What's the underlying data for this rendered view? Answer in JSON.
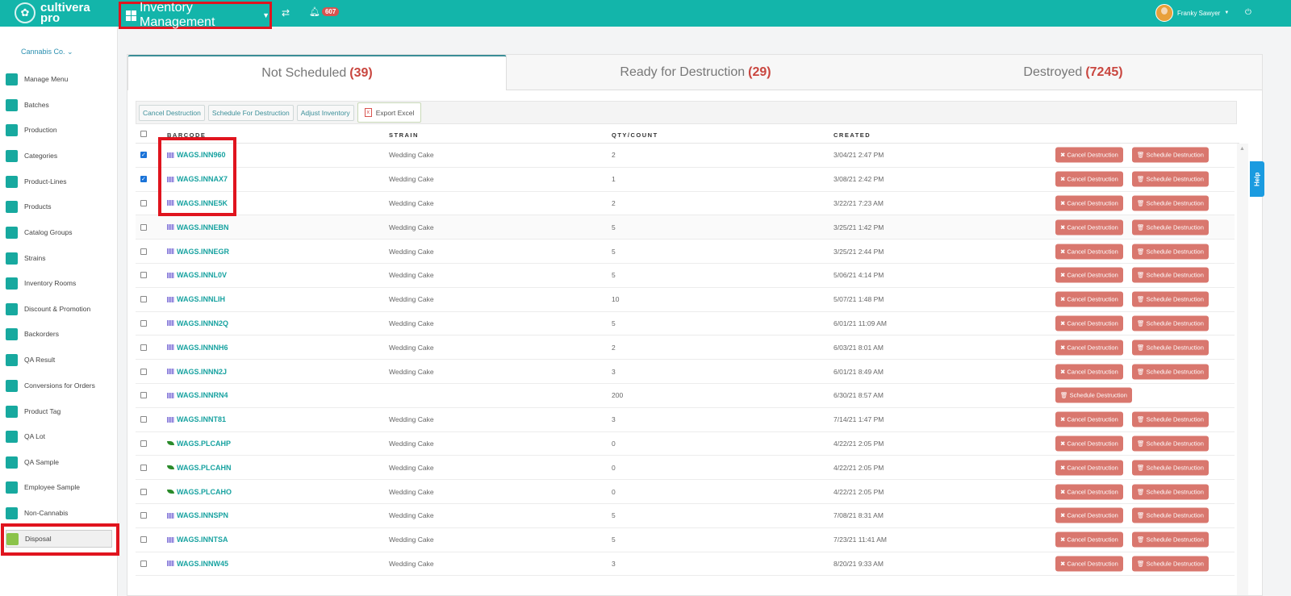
{
  "topbar": {
    "logo_line1": "cultivera",
    "logo_line2": "pro",
    "module_title": "Inventory Management",
    "notifications_count": "607",
    "user_name": "Franky Sawyer"
  },
  "sidebar": {
    "company": "Cannabis Co.",
    "items": [
      {
        "label": "Manage Menu"
      },
      {
        "label": "Batches"
      },
      {
        "label": "Production"
      },
      {
        "label": "Categories"
      },
      {
        "label": "Product-Lines"
      },
      {
        "label": "Products"
      },
      {
        "label": "Catalog Groups"
      },
      {
        "label": "Strains"
      },
      {
        "label": "Inventory Rooms"
      },
      {
        "label": "Discount & Promotion"
      },
      {
        "label": "Backorders"
      },
      {
        "label": "QA Result"
      },
      {
        "label": "Conversions for Orders"
      },
      {
        "label": "Product Tag"
      },
      {
        "label": "QA Lot"
      },
      {
        "label": "QA Sample"
      },
      {
        "label": "Employee Sample"
      },
      {
        "label": "Non-Cannabis"
      },
      {
        "label": "Disposal"
      }
    ],
    "active": "Disposal"
  },
  "tabs": [
    {
      "label": "Not Scheduled",
      "count": "(39)"
    },
    {
      "label": "Ready for Destruction",
      "count": "(29)"
    },
    {
      "label": "Destroyed",
      "count": "(7245)"
    }
  ],
  "toolbar": {
    "cancel": "Cancel Destruction",
    "schedule": "Schedule For Destruction",
    "adjust": "Adjust Inventory",
    "export": "Export Excel"
  },
  "table": {
    "headers": {
      "barcode": "BARCODE",
      "strain": "STRAIN",
      "qty": "QTY/COUNT",
      "created": "CREATED"
    },
    "cancel_label": "Cancel Destruction",
    "schedule_label": "Schedule Destruction",
    "rows": [
      {
        "barcode": "WAGS.INN960",
        "icon": "barcode",
        "strain": "Wedding Cake",
        "qty": "2",
        "created": "3/04/21 2:47 PM",
        "checked": true,
        "cancel": true
      },
      {
        "barcode": "WAGS.INNAX7",
        "icon": "barcode",
        "strain": "Wedding Cake",
        "qty": "1",
        "created": "3/08/21 2:42 PM",
        "checked": true,
        "cancel": true
      },
      {
        "barcode": "WAGS.INNE5K",
        "icon": "barcode",
        "strain": "Wedding Cake",
        "qty": "2",
        "created": "3/22/21 7:23 AM",
        "checked": false,
        "cancel": true
      },
      {
        "barcode": "WAGS.INNEBN",
        "icon": "barcode",
        "strain": "Wedding Cake",
        "qty": "5",
        "created": "3/25/21 1:42 PM",
        "checked": false,
        "cancel": true
      },
      {
        "barcode": "WAGS.INNEGR",
        "icon": "barcode",
        "strain": "Wedding Cake",
        "qty": "5",
        "created": "3/25/21 2:44 PM",
        "checked": false,
        "cancel": true
      },
      {
        "barcode": "WAGS.INNL0V",
        "icon": "barcode",
        "strain": "Wedding Cake",
        "qty": "5",
        "created": "5/06/21 4:14 PM",
        "checked": false,
        "cancel": true
      },
      {
        "barcode": "WAGS.INNLIH",
        "icon": "barcode",
        "strain": "Wedding Cake",
        "qty": "10",
        "created": "5/07/21 1:48 PM",
        "checked": false,
        "cancel": true
      },
      {
        "barcode": "WAGS.INNN2Q",
        "icon": "barcode",
        "strain": "Wedding Cake",
        "qty": "5",
        "created": "6/01/21 11:09 AM",
        "checked": false,
        "cancel": true
      },
      {
        "barcode": "WAGS.INNNH6",
        "icon": "barcode",
        "strain": "Wedding Cake",
        "qty": "2",
        "created": "6/03/21 8:01 AM",
        "checked": false,
        "cancel": true
      },
      {
        "barcode": "WAGS.INNN2J",
        "icon": "barcode",
        "strain": "Wedding Cake",
        "qty": "3",
        "created": "6/01/21 8:49 AM",
        "checked": false,
        "cancel": true
      },
      {
        "barcode": "WAGS.INNRN4",
        "icon": "barcode",
        "strain": "",
        "qty": "200",
        "created": "6/30/21 8:57 AM",
        "checked": false,
        "cancel": false
      },
      {
        "barcode": "WAGS.INNT81",
        "icon": "barcode",
        "strain": "Wedding Cake",
        "qty": "3",
        "created": "7/14/21 1:47 PM",
        "checked": false,
        "cancel": true
      },
      {
        "barcode": "WAGS.PLCAHP",
        "icon": "leaf",
        "strain": "Wedding Cake",
        "qty": "0",
        "created": "4/22/21 2:05 PM",
        "checked": false,
        "cancel": true
      },
      {
        "barcode": "WAGS.PLCAHN",
        "icon": "leaf",
        "strain": "Wedding Cake",
        "qty": "0",
        "created": "4/22/21 2:05 PM",
        "checked": false,
        "cancel": true
      },
      {
        "barcode": "WAGS.PLCAHO",
        "icon": "leaf",
        "strain": "Wedding Cake",
        "qty": "0",
        "created": "4/22/21 2:05 PM",
        "checked": false,
        "cancel": true
      },
      {
        "barcode": "WAGS.INNSPN",
        "icon": "barcode",
        "strain": "Wedding Cake",
        "qty": "5",
        "created": "7/08/21 8:31 AM",
        "checked": false,
        "cancel": true
      },
      {
        "barcode": "WAGS.INNTSA",
        "icon": "barcode",
        "strain": "Wedding Cake",
        "qty": "5",
        "created": "7/23/21 11:41 AM",
        "checked": false,
        "cancel": true
      },
      {
        "barcode": "WAGS.INNW45",
        "icon": "barcode",
        "strain": "Wedding Cake",
        "qty": "3",
        "created": "8/20/21 9:33 AM",
        "checked": false,
        "cancel": true
      }
    ]
  },
  "help_label": "Help"
}
